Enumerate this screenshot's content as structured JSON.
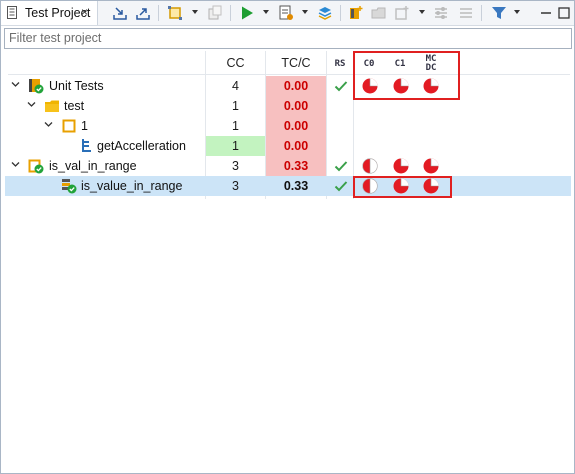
{
  "tab": {
    "title": "Test Project",
    "close_glyph": "×",
    "icon": "test-project-icon"
  },
  "toolbar": {
    "buttons": [
      "import-icon",
      "export-icon",
      "select-icon",
      "copy-icon",
      "run-icon",
      "report-icon",
      "stack-icon",
      "new-test-icon",
      "folder-icon",
      "add-icon",
      "settings-icon",
      "filter-icon",
      "maximize-icon"
    ]
  },
  "filter": {
    "placeholder": "Filter test project",
    "value": ""
  },
  "columns": {
    "cc": "CC",
    "tcc": "TC/C",
    "rs": "RS",
    "c0": "C0",
    "c1": "C1",
    "mcdc_line1": "MC",
    "mcdc_line2": "DC"
  },
  "rows": [
    {
      "label": "Unit Tests",
      "cc": "4",
      "tcc": "0.00"
    },
    {
      "label": "test",
      "cc": "1",
      "tcc": "0.00"
    },
    {
      "label": "1",
      "cc": "1",
      "tcc": "0.00"
    },
    {
      "label": "getAccelleration",
      "cc": "1",
      "tcc": "0.00"
    },
    {
      "label": "is_val_in_range",
      "cc": "3",
      "tcc": "0.33"
    },
    {
      "label": "is_value_in_range",
      "cc": "3",
      "tcc": "0.33"
    }
  ],
  "colors": {
    "fail_bg": "#f7c0c0",
    "fail_text": "#cc0000",
    "pass_bg": "#c3f3c0",
    "selection": "#cce4f7",
    "highlight_box": "#e02020",
    "coverage_red": "#e31b23"
  }
}
